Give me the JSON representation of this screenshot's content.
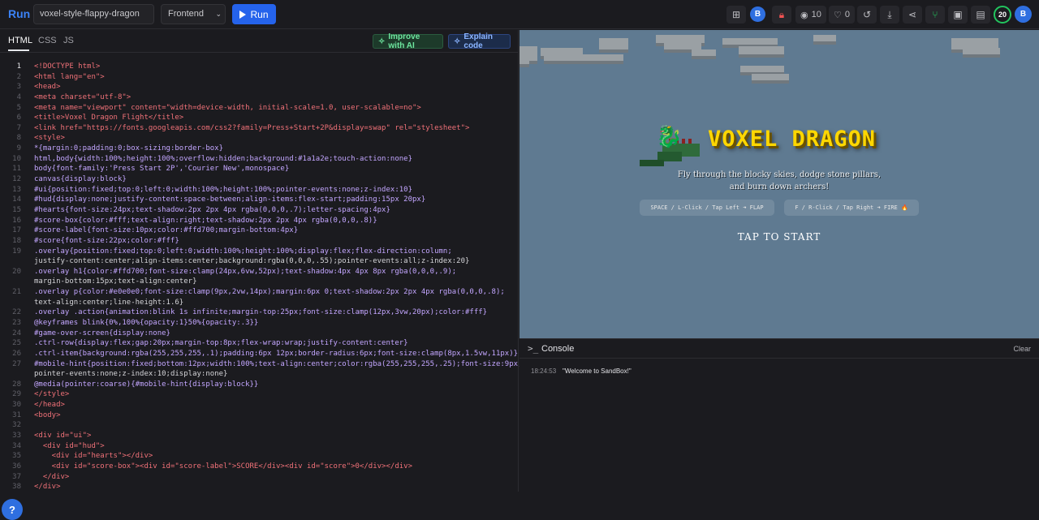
{
  "header": {
    "logo": "Run",
    "project_name": "voxel-style-flappy-dragon",
    "framework": "Frontend",
    "run_label": "Run",
    "avatar_initial": "B",
    "views": "10",
    "likes": "0",
    "level": "20",
    "user_initial": "B"
  },
  "editor": {
    "tabs": [
      "HTML",
      "CSS",
      "JS"
    ],
    "active_tab": "HTML",
    "improve_label": "Improve with AI",
    "explain_label": "Explain code",
    "current_line": 1,
    "lines": [
      "<!DOCTYPE html>",
      "<html lang=\"en\">",
      "<head>",
      "<meta charset=\"utf-8\">",
      "<meta name=\"viewport\" content=\"width=device-width, initial-scale=1.0, user-scalable=no\">",
      "<title>Voxel Dragon Flight</title>",
      "<link href=\"https://fonts.googleapis.com/css2?family=Press+Start+2P&display=swap\" rel=\"stylesheet\">",
      "<style>",
      "*{margin:0;padding:0;box-sizing:border-box}",
      "html,body{width:100%;height:100%;overflow:hidden;background:#1a1a2e;touch-action:none}",
      "body{font-family:'Press Start 2P','Courier New',monospace}",
      "canvas{display:block}",
      "#ui{position:fixed;top:0;left:0;width:100%;height:100%;pointer-events:none;z-index:10}",
      "#hud{display:none;justify-content:space-between;align-items:flex-start;padding:15px 20px}",
      "#hearts{font-size:24px;text-shadow:2px 2px 4px rgba(0,0,0,.7);letter-spacing:4px}",
      "#score-box{color:#fff;text-align:right;text-shadow:2px 2px 4px rgba(0,0,0,.8)}",
      "#score-label{font-size:10px;color:#ffd700;margin-bottom:4px}",
      "#score{font-size:22px;color:#fff}",
      ".overlay{position:fixed;top:0;left:0;width:100%;height:100%;display:flex;flex-direction:column;",
      "justify-content:center;align-items:center;background:rgba(0,0,0,.55);pointer-events:all;z-index:20}",
      ".overlay h1{color:#ffd700;font-size:clamp(24px,6vw,52px);text-shadow:4px 4px 8px rgba(0,0,0,.9);",
      "margin-bottom:15px;text-align:center}",
      ".overlay p{color:#e0e0e0;font-size:clamp(9px,2vw,14px);margin:6px 0;text-shadow:2px 2px 4px rgba(0,0,0,.8);",
      "text-align:center;line-height:1.6}",
      ".overlay .action{animation:blink 1s infinite;margin-top:25px;font-size:clamp(12px,3vw,20px);color:#fff}",
      "@keyframes blink{0%,100%{opacity:1}50%{opacity:.3}}",
      "#game-over-screen{display:none}",
      ".ctrl-row{display:flex;gap:20px;margin-top:8px;flex-wrap:wrap;justify-content:center}",
      ".ctrl-item{background:rgba(255,255,255,.1);padding:6px 12px;border-radius:6px;font-size:clamp(8px,1.5vw,11px)}",
      "#mobile-hint{position:fixed;bottom:12px;width:100%;text-align:center;color:rgba(255,255,255,.25);font-size:9px;",
      "pointer-events:none;z-index:10;display:none}",
      "@media(pointer:coarse){#mobile-hint{display:block}}",
      "</style>",
      "</head>",
      "<body>",
      "",
      "<div id=\"ui\">",
      "  <div id=\"hud\">",
      "    <div id=\"hearts\"></div>",
      "    <div id=\"score-box\"><div id=\"score-label\">SCORE</div><div id=\"score\">0</div></div>",
      "  </div>",
      "</div>"
    ],
    "line_numbers": [
      "1",
      "2",
      "3",
      "4",
      "5",
      "6",
      "7",
      "8",
      "9",
      "10",
      "11",
      "12",
      "13",
      "14",
      "15",
      "16",
      "17",
      "18",
      "19",
      "",
      "20",
      "",
      "21",
      "",
      "22",
      "23",
      "24",
      "25",
      "26",
      "27",
      "",
      "28",
      "29",
      "30",
      "31",
      "32",
      "33",
      "34",
      "35",
      "36",
      "37",
      "38"
    ]
  },
  "preview": {
    "game_title": "VOXEL DRAGON",
    "dragon_emoji": "🐉",
    "subtitle_line1": "Fly through the blocky skies, dodge stone pillars,",
    "subtitle_line2": "and burn down archers!",
    "control_flap": "SPACE / L-Click / Tap Left ➜ FLAP",
    "control_fire": "F / R-Click / Tap Right ➜ FIRE 🔥",
    "action": "TAP TO START",
    "sky_color": "#5f7a91",
    "title_color": "#ffd700"
  },
  "console": {
    "title": "Console",
    "clear_label": "Clear",
    "logs": [
      {
        "time": "18:24:53",
        "message": "\"Welcome to SandBox!\""
      }
    ]
  }
}
